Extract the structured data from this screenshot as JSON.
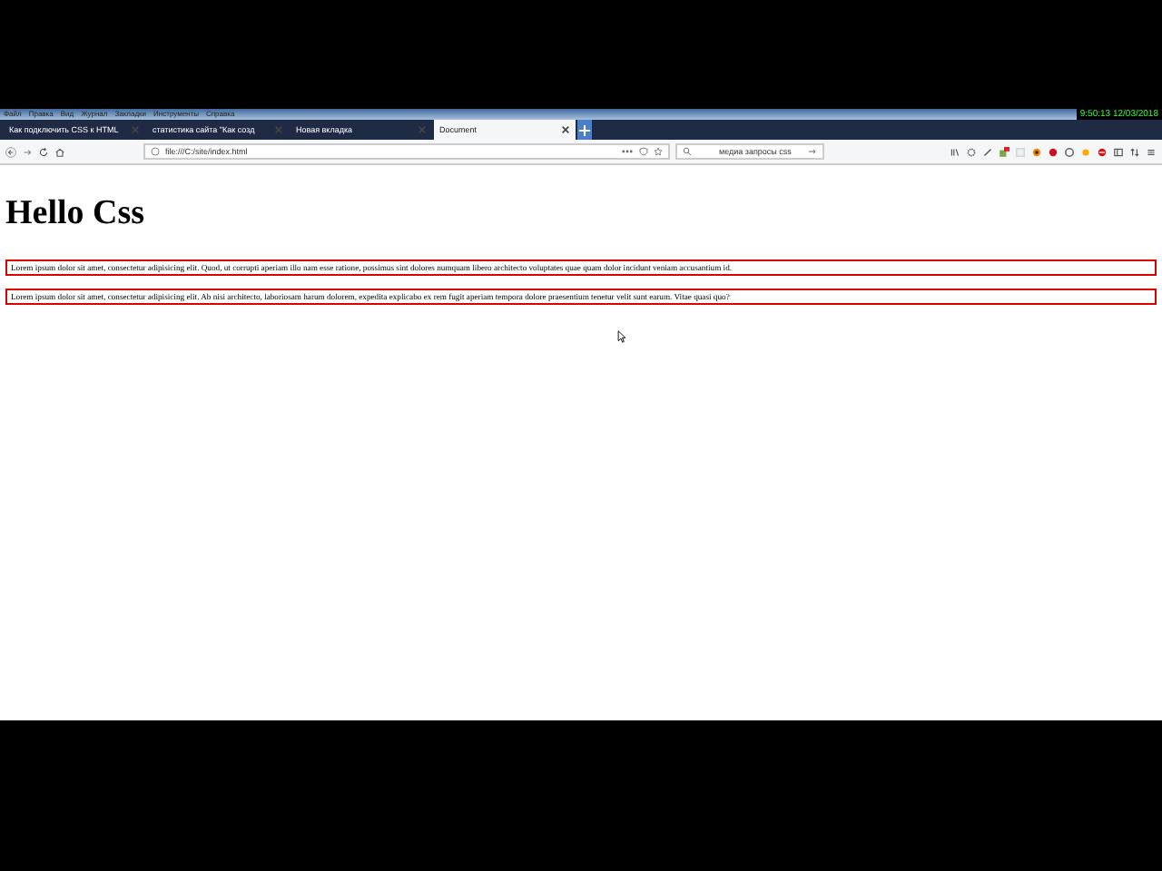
{
  "menu": [
    "Файл",
    "Правка",
    "Вид",
    "Журнал",
    "Закладки",
    "Инструменты",
    "Справка"
  ],
  "clock": "9:50:13  12/03/2018",
  "tabs": [
    {
      "label": "Как подключить CSS к HTML",
      "selected": false
    },
    {
      "label": "статистика сайта \"Как созд",
      "selected": false
    },
    {
      "label": "Новая вкладка",
      "selected": false
    },
    {
      "label": "Document",
      "selected": true
    }
  ],
  "address": {
    "value": "file:///C:/site/index.html"
  },
  "search": {
    "value": "медиа запросы css"
  },
  "page": {
    "heading": "Hello Css",
    "paragraphs": [
      "Lorem ipsum dolor sit amet, consectetur adipisicing elit. Quod, ut corrupti aperiam illo nam esse ratione, possimus sint dolores numquam libero architecto voluptates quae quam dolor incidunt veniam accusantium id.",
      "Lorem ipsum dolor sit amet, consectetur adipisicing elit. Ab nisi architecto, laboriosam harum dolorem, expedita explicabo ex rem fugit aperiam tempora dolore praesentium tenetur velit sunt earum. Vitae quasi quo?"
    ]
  }
}
